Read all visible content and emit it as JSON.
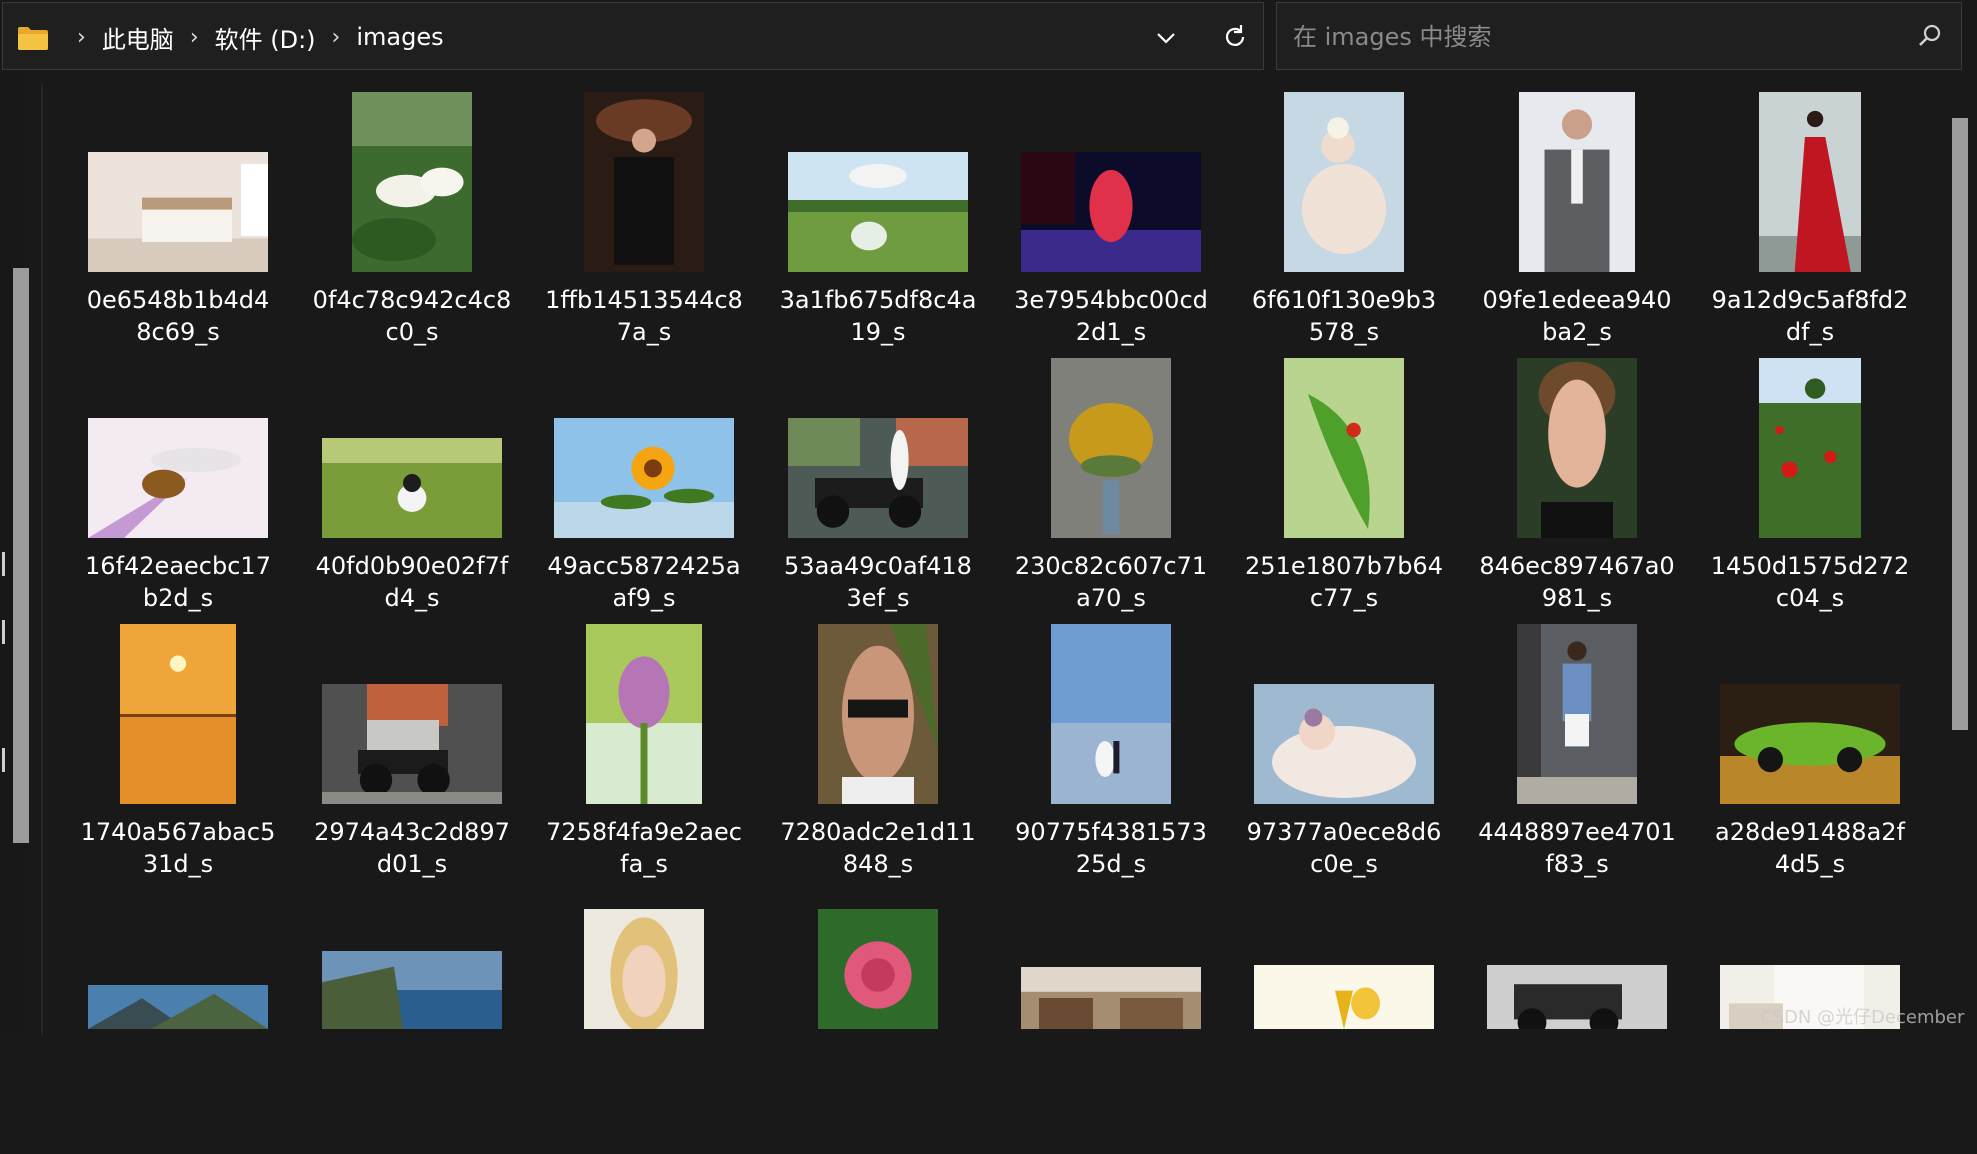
{
  "addressbar": {
    "crumbs": [
      "此电脑",
      "软件 (D:)",
      "images"
    ],
    "separator": "›"
  },
  "search": {
    "placeholder": "在 images 中搜索"
  },
  "colors": {
    "background": "#191919",
    "bar": "#1f1f1f",
    "text": "#ffffff",
    "placeholder": "#8a8a8a"
  },
  "icons": {
    "folder": "folder-icon",
    "dropdown": "chevron-down-icon",
    "refresh": "refresh-icon",
    "search": "search-icon"
  },
  "files": [
    {
      "line1": "0e6548b1b4d4",
      "line2": "8c69_s",
      "thumb": "bedroom",
      "orient": "landscape"
    },
    {
      "line1": "0f4c78c942c4c8",
      "line2": "c0_s",
      "thumb": "lotus",
      "orient": "portrait"
    },
    {
      "line1": "1ffb14513544c8",
      "line2": "7a_s",
      "thumb": "woman-dark",
      "orient": "portrait"
    },
    {
      "line1": "3a1fb675df8c4a",
      "line2": "19_s",
      "thumb": "umbrella-field",
      "orient": "landscape"
    },
    {
      "line1": "3e7954bbc00cd",
      "line2": "2d1_s",
      "thumb": "neon-red",
      "orient": "landscape"
    },
    {
      "line1": "6f610f130e9b3",
      "line2": "578_s",
      "thumb": "baby-blue",
      "orient": "portrait"
    },
    {
      "line1": "09fe1edeea940",
      "line2": "ba2_s",
      "thumb": "suit-man",
      "orient": "portrait"
    },
    {
      "line1": "9a12d9c5af8fd2",
      "line2": "df_s",
      "thumb": "red-dress",
      "orient": "portrait"
    },
    {
      "line1": "16f42eaecbc17",
      "line2": "b2d_s",
      "thumb": "hoverfly",
      "orient": "landscape"
    },
    {
      "line1": "40fd0b90e02f7f",
      "line2": "d4_s",
      "thumb": "cat-grass",
      "orient": "landscape"
    },
    {
      "line1": "49acc5872425a",
      "line2": "af9_s",
      "thumb": "sunflower",
      "orient": "landscape"
    },
    {
      "line1": "53aa49c0af418",
      "line2": "3ef_s",
      "thumb": "motorbike",
      "orient": "landscape"
    },
    {
      "line1": "230c82c607c71",
      "line2": "a70_s",
      "thumb": "lilies-vase",
      "orient": "portrait"
    },
    {
      "line1": "251e1807b7b64",
      "line2": "c77_s",
      "thumb": "ladybug-leaf",
      "orient": "portrait"
    },
    {
      "line1": "846ec897467a0",
      "line2": "981_s",
      "thumb": "portrait-woman",
      "orient": "portrait"
    },
    {
      "line1": "1450d1575d272",
      "line2": "c04_s",
      "thumb": "poppies",
      "orient": "portrait"
    },
    {
      "line1": "1740a567abac5",
      "line2": "31d_s",
      "thumb": "sunset-sea",
      "orient": "portrait"
    },
    {
      "line1": "2974a43c2d897",
      "line2": "d01_s",
      "thumb": "motorbike-2",
      "orient": "landscape"
    },
    {
      "line1": "7258f4fa9e2aec",
      "line2": "fa_s",
      "thumb": "lotus-bud",
      "orient": "portrait"
    },
    {
      "line1": "7280adc2e1d11",
      "line2": "848_s",
      "thumb": "sunglasses",
      "orient": "portrait"
    },
    {
      "line1": "90775f4381573",
      "line2": "25d_s",
      "thumb": "beach-couple",
      "orient": "portrait"
    },
    {
      "line1": "97377a0ece8d6",
      "line2": "c0e_s",
      "thumb": "baby-sleep",
      "orient": "landscape"
    },
    {
      "line1": "4448897ee4701",
      "line2": "f83_s",
      "thumb": "singer-street",
      "orient": "portrait"
    },
    {
      "line1": "a28de91488a2f",
      "line2": "4d5_s",
      "thumb": "green-car",
      "orient": "landscape"
    },
    {
      "line1": "",
      "line2": "",
      "thumb": "mountains",
      "orient": "partial"
    },
    {
      "line1": "",
      "line2": "",
      "thumb": "coast",
      "orient": "partial"
    },
    {
      "line1": "",
      "line2": "",
      "thumb": "blonde-book",
      "orient": "partial"
    },
    {
      "line1": "",
      "line2": "",
      "thumb": "rose",
      "orient": "partial"
    },
    {
      "line1": "",
      "line2": "",
      "thumb": "cafe",
      "orient": "partial"
    },
    {
      "line1": "",
      "line2": "",
      "thumb": "yellow-flower",
      "orient": "partial"
    },
    {
      "line1": "",
      "line2": "",
      "thumb": "vintage-car",
      "orient": "partial"
    },
    {
      "line1": "",
      "line2": "",
      "thumb": "white-room",
      "orient": "partial"
    }
  ],
  "watermark": "CSDN @光仔December"
}
